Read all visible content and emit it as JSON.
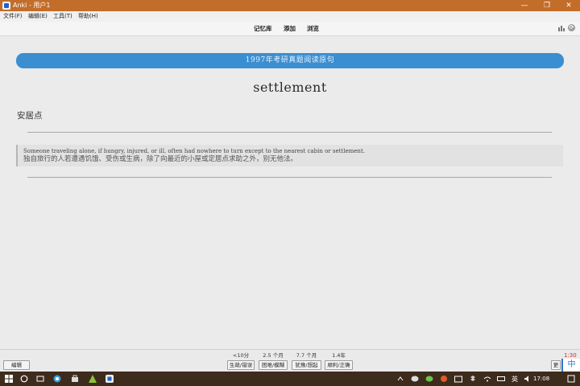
{
  "window": {
    "title": "Anki - 用户1",
    "minimize": "—",
    "maximize": "❐",
    "close": "✕"
  },
  "menu": [
    "文件(F)",
    "编辑(E)",
    "工具(T)",
    "帮助(H)"
  ],
  "toolbar": {
    "decks": "记忆库",
    "add": "添加",
    "browse": "浏览",
    "stats_icon": "bar-chart-icon",
    "sync_icon": "sync-icon"
  },
  "card": {
    "deck_banner": "1997年考研真题阅读原句",
    "word": "settlement",
    "meaning": "安居点",
    "example_en": "Someone traveling alone, if hungry, injured, or ill, often had nowhere to turn except to the nearest cabin or settlement.",
    "example_zh": "独自旅行的人若遭遇饥饿、受伤或生病，除了向最近的小屋或定居点求助之外，别无他法。"
  },
  "bottom": {
    "edit": "编辑",
    "more": "更",
    "timer": "1:30",
    "answers": [
      {
        "interval": "<10分",
        "label": "生疏/错误"
      },
      {
        "interval": "2.5 个月",
        "label": "困难/模糊"
      },
      {
        "interval": "7.7 个月",
        "label": "犹豫/想起"
      },
      {
        "interval": "1.4年",
        "label": "顺利/正确"
      }
    ]
  },
  "ime": "中",
  "taskbar": {
    "time": "17:08"
  },
  "colors": {
    "titlebar": "#c36d2a",
    "banner": "#3b8fd0",
    "timer": "#d03030",
    "taskbar": "#3d2b1c"
  }
}
